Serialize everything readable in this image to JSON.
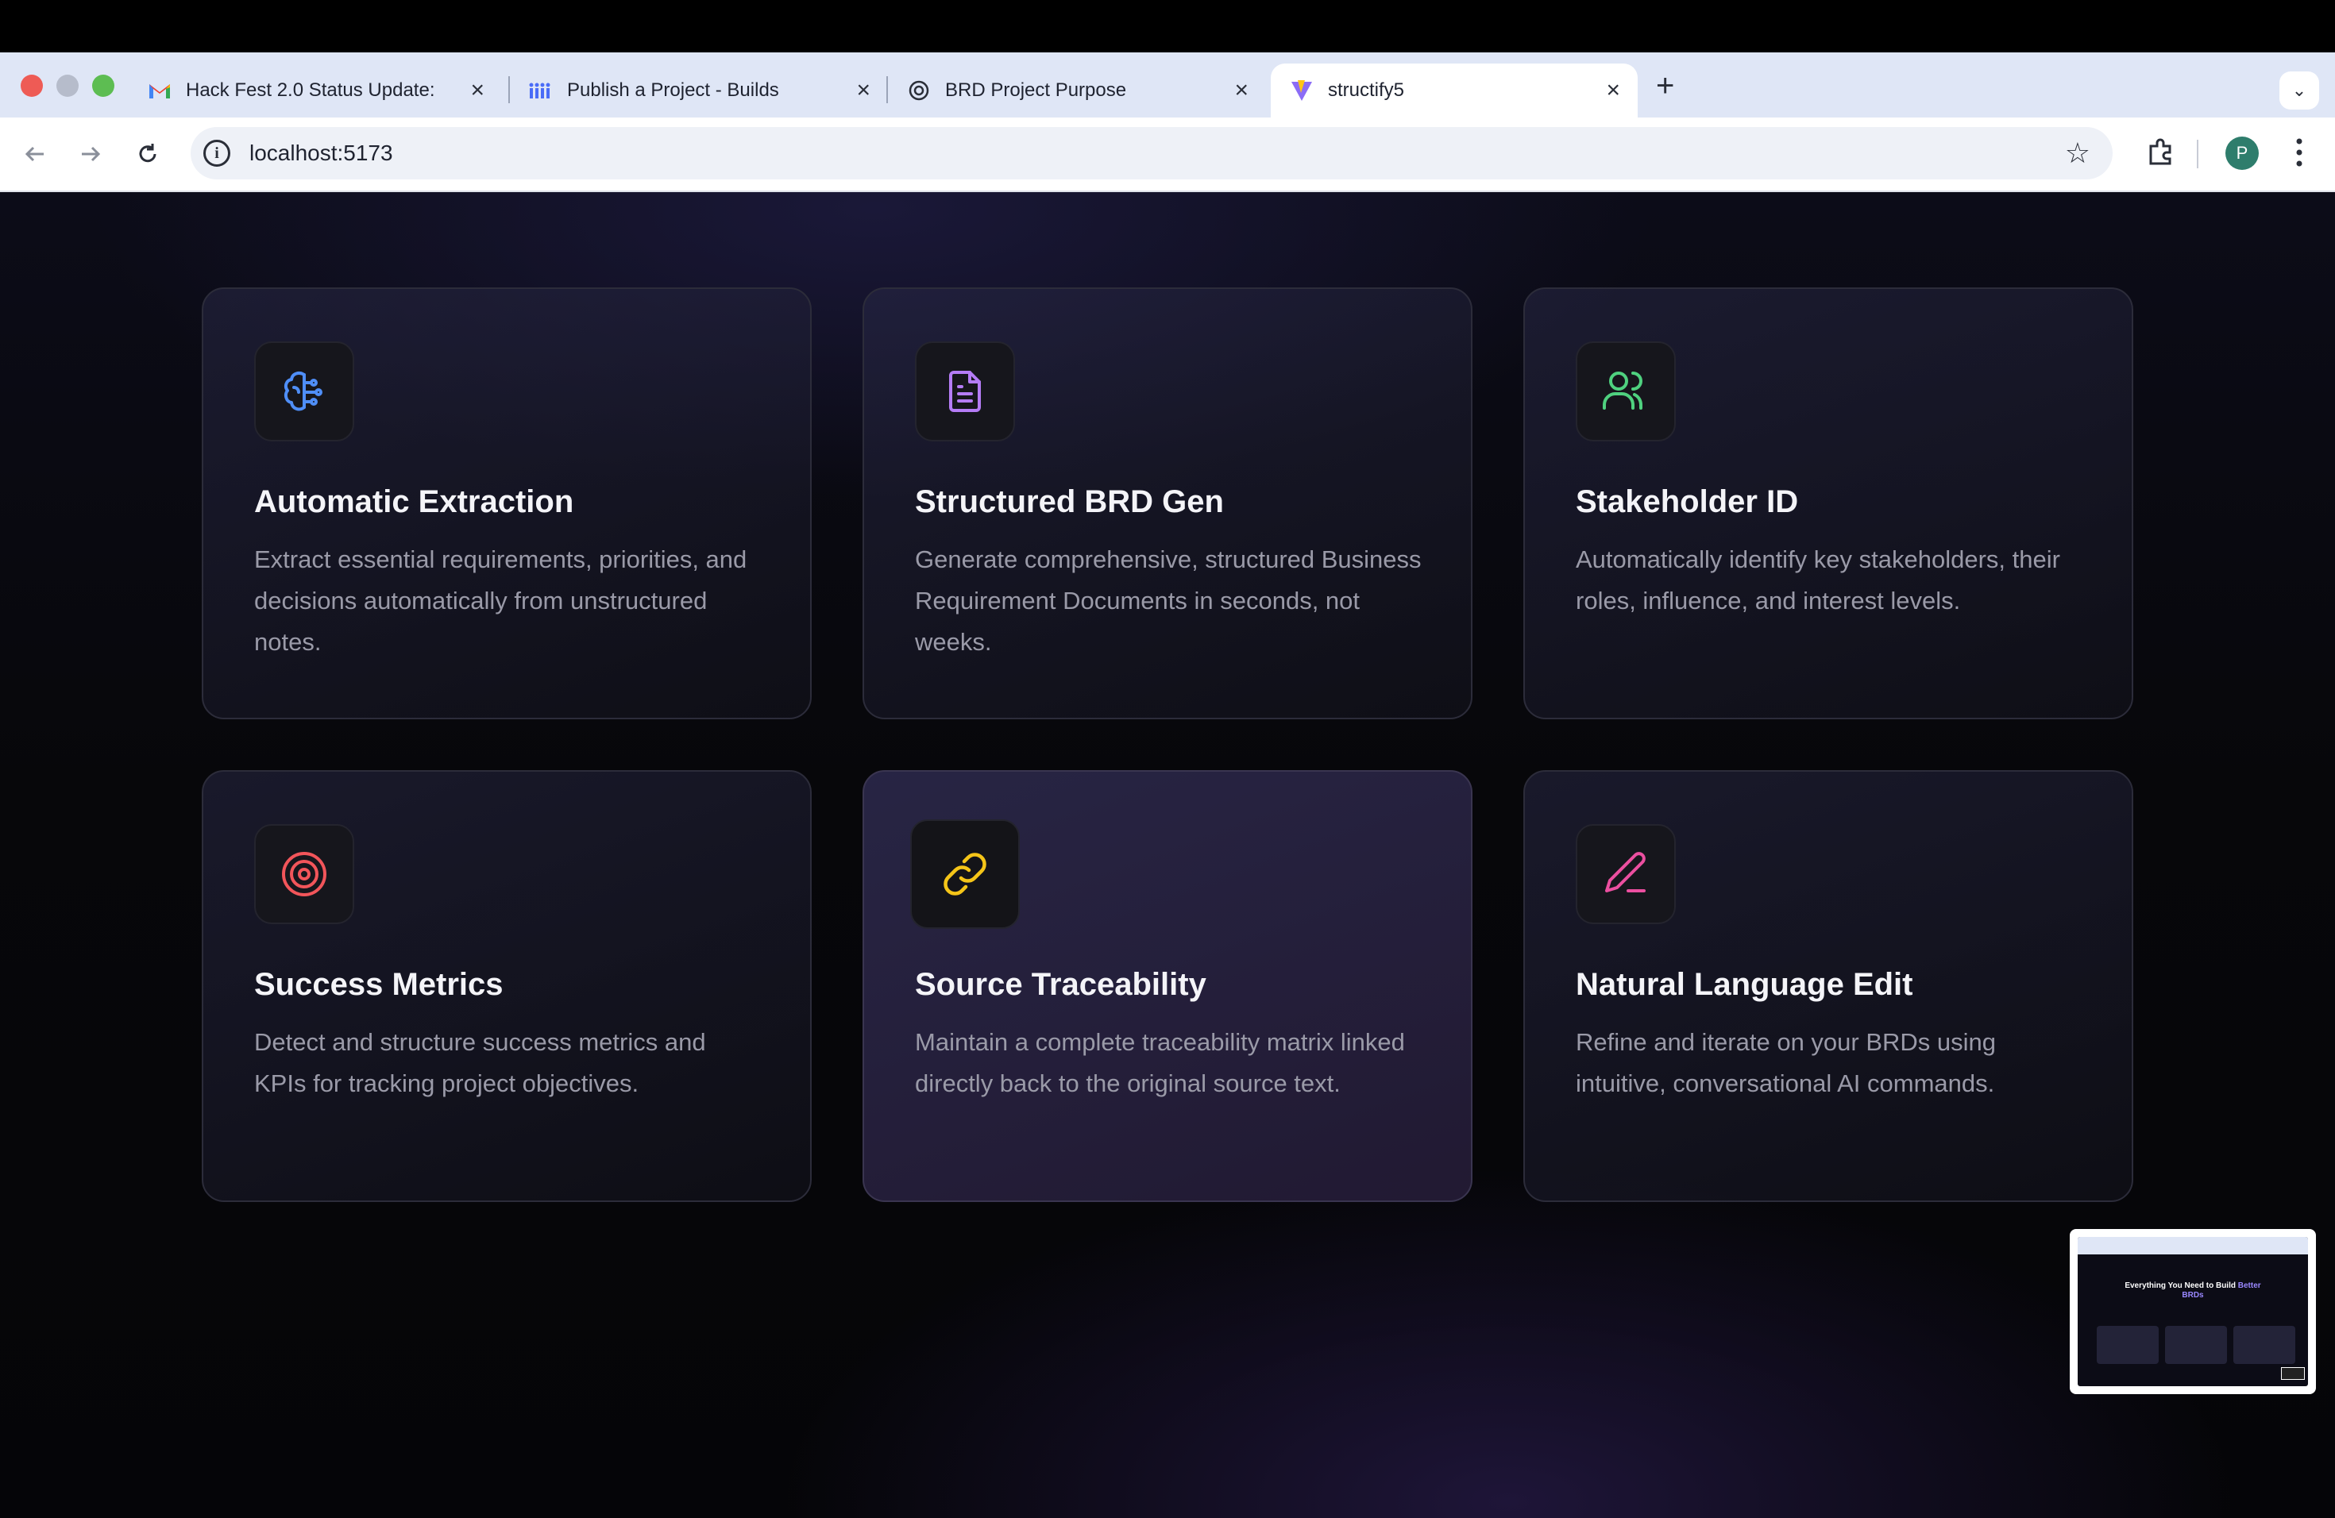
{
  "browser": {
    "tabs": [
      {
        "title": "Hack Fest 2.0 Status Update:",
        "icon": "gmail-icon",
        "active": false
      },
      {
        "title": "Publish a Project - Builds",
        "icon": "builds-icon",
        "active": false
      },
      {
        "title": "BRD Project Purpose",
        "icon": "openai-icon",
        "active": false
      },
      {
        "title": "structify5",
        "icon": "vite-icon",
        "active": true
      }
    ],
    "new_tab_label": "+",
    "url": "localhost:5173",
    "profile_initial": "P"
  },
  "features": [
    {
      "title": "Automatic Extraction",
      "description": "Extract essential requirements, priorities, and decisions automatically from unstructured notes.",
      "icon": "brain-icon",
      "color": "#4f8ef7"
    },
    {
      "title": "Structured BRD Gen",
      "description": "Generate comprehensive, structured Business Requirement Documents in seconds, not weeks.",
      "icon": "document-icon",
      "color": "#b57cf6"
    },
    {
      "title": "Stakeholder ID",
      "description": "Automatically identify key stakeholders, their roles, influence, and interest levels.",
      "icon": "users-icon",
      "color": "#4fd17f"
    },
    {
      "title": "Success Metrics",
      "description": "Detect and structure success metrics and KPIs for tracking project objectives.",
      "icon": "target-icon",
      "color": "#f2555a"
    },
    {
      "title": "Source Traceability",
      "description": "Maintain a complete traceability matrix linked directly back to the original source text.",
      "icon": "link-icon",
      "color": "#f5c518"
    },
    {
      "title": "Natural Language Edit",
      "description": "Refine and iterate on your BRDs using intuitive, conversational AI commands.",
      "icon": "pencil-icon",
      "color": "#ec4fa0"
    }
  ],
  "preview": {
    "title_main": "Everything You Need to Build",
    "title_accent": "Better",
    "title_end": "BRDs"
  }
}
